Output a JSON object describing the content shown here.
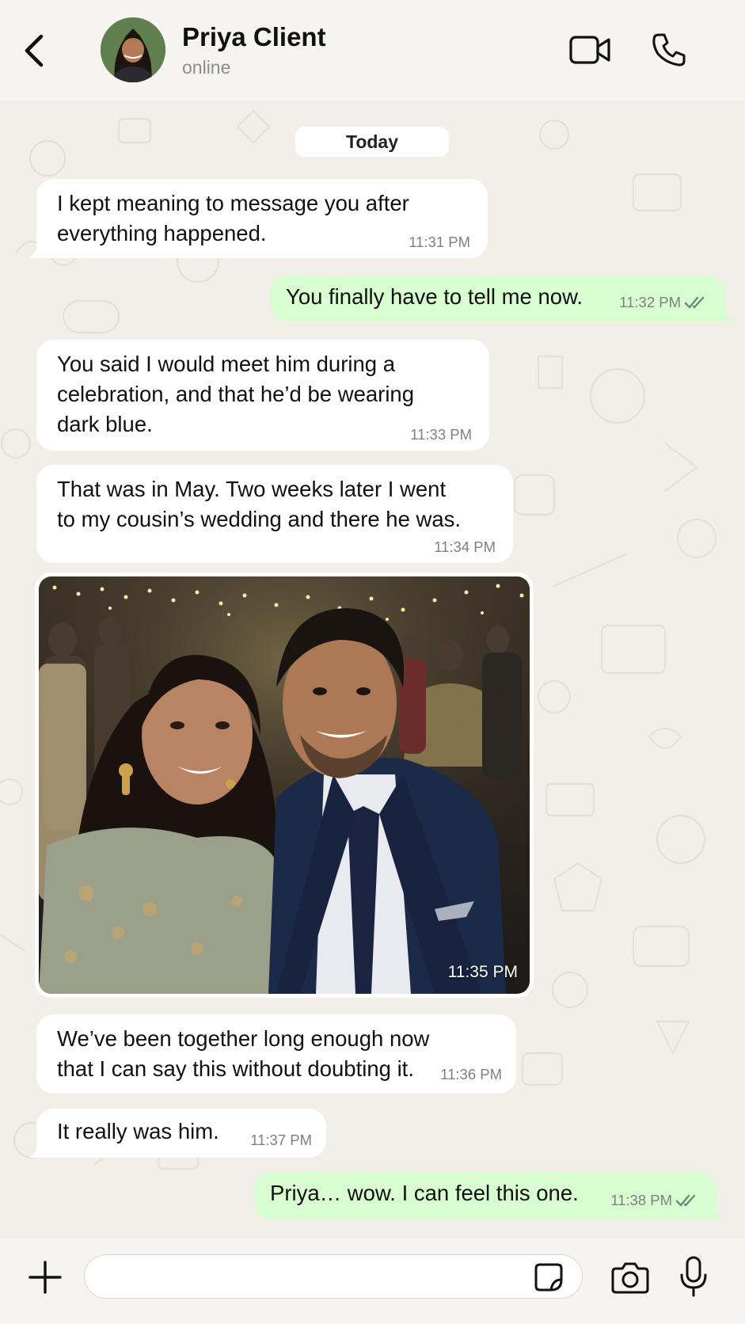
{
  "header": {
    "name": "Priya Client",
    "status": "online"
  },
  "day_label": "Today",
  "messages": [
    {
      "direction": "in",
      "lines": [
        "I kept meaning to message you after",
        "everything happened."
      ],
      "time": "11:31 PM"
    },
    {
      "direction": "out",
      "lines": [
        "You finally have to tell me now."
      ],
      "time": "11:32 PM",
      "read": true
    },
    {
      "direction": "in",
      "lines": [
        "You said I would meet him during a",
        "celebration, and that he’d be wearing",
        "dark blue."
      ],
      "time": "11:33 PM"
    },
    {
      "direction": "in",
      "lines": [
        "That was in May. Two weeks later I went",
        "to my cousin’s wedding and there he was."
      ],
      "time": "11:34 PM"
    },
    {
      "direction": "in",
      "type": "photo",
      "time": "11:35 PM"
    },
    {
      "direction": "in",
      "lines": [
        "We’ve been together long enough now",
        "that I can say this without doubting it."
      ],
      "time": "11:36 PM"
    },
    {
      "direction": "in",
      "lines": [
        "It really was him."
      ],
      "time": "11:37 PM"
    },
    {
      "direction": "out",
      "lines": [
        "Priya… wow. I can feel this one."
      ],
      "time": "11:38 PM",
      "read": true
    }
  ],
  "input": {
    "placeholder": ""
  },
  "colors": {
    "background": "#f2efe9",
    "incoming_bubble": "#ffffff",
    "outgoing_bubble": "#d8fdd0",
    "read_ticks": "#6f8a7a"
  },
  "icons": [
    "back-arrow-icon",
    "video-call-icon",
    "phone-icon",
    "plus-icon",
    "sticker-icon",
    "camera-icon",
    "microphone-icon",
    "double-check-icon"
  ]
}
